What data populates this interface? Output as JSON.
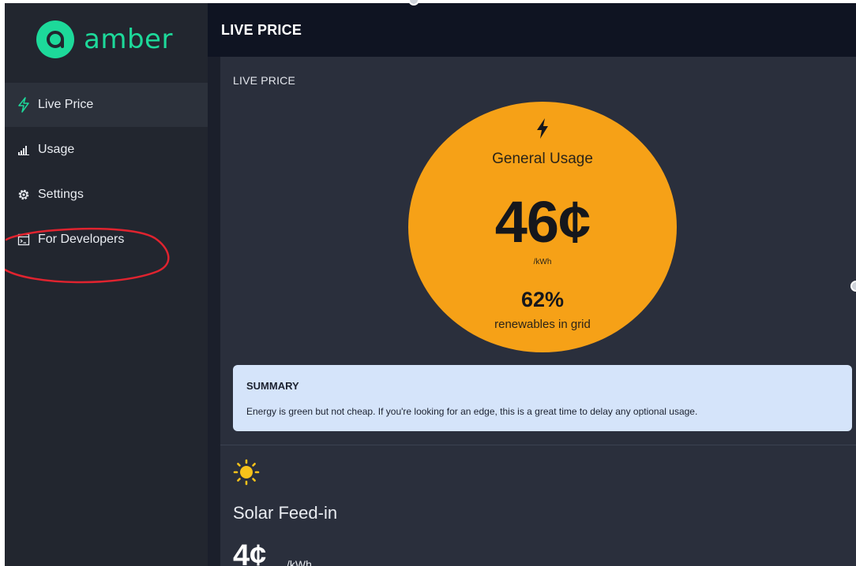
{
  "app": {
    "brand": "amber",
    "brand_color": "#1dd99a"
  },
  "sidebar": {
    "items": [
      {
        "label": "Live Price",
        "icon": "bolt-icon",
        "active": true
      },
      {
        "label": "Usage",
        "icon": "bar-chart-icon",
        "active": false
      },
      {
        "label": "Settings",
        "icon": "gear-icon",
        "active": false
      },
      {
        "label": "For Developers",
        "icon": "terminal-icon",
        "active": false
      }
    ]
  },
  "header": {
    "title": "LIVE PRICE"
  },
  "live_price": {
    "card_label": "LIVE PRICE",
    "usage_title": "General Usage",
    "price": "46¢",
    "unit": "/kWh",
    "renewables": "62%",
    "renewables_label": "renewables in grid",
    "circle_color": "#f6a117"
  },
  "summary": {
    "title": "SUMMARY",
    "text": "Energy is green but not cheap. If you're looking for an edge, this is a great time to delay any optional usage."
  },
  "solar": {
    "title": "Solar Feed-in",
    "price": "4¢",
    "unit": "/kWh",
    "icon": "sun-icon"
  },
  "colors": {
    "annotation_circle": "#e0232f"
  }
}
